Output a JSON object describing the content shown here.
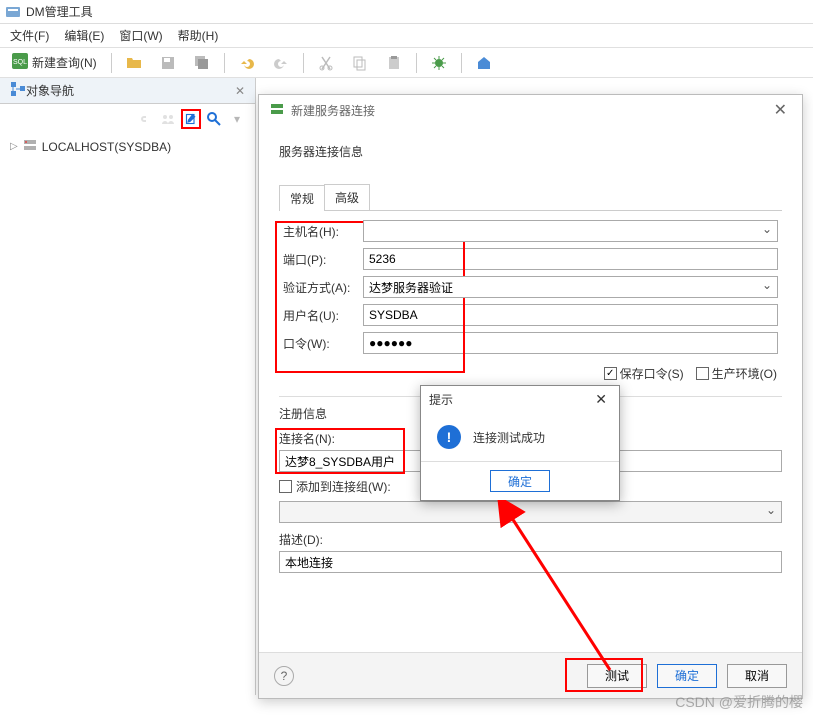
{
  "app": {
    "title": "DM管理工具"
  },
  "menu": {
    "file": "文件(F)",
    "edit": "编辑(E)",
    "window": "窗口(W)",
    "help": "帮助(H)"
  },
  "toolbar": {
    "new_query": "新建查询(N)"
  },
  "sidebar": {
    "tab_title": "对象导航",
    "tree_root": "LOCALHOST(SYSDBA)"
  },
  "dialog": {
    "title": "新建服务器连接",
    "section1": "服务器连接信息",
    "tabs": {
      "general": "常规",
      "advanced": "高级"
    },
    "labels": {
      "host": "主机名(H):",
      "port": "端口(P):",
      "auth": "验证方式(A):",
      "user": "用户名(U):",
      "pwd": "口令(W):"
    },
    "values": {
      "host": "",
      "port": "5236",
      "auth": "达梦服务器验证",
      "user": "SYSDBA",
      "pwd": "●●●●●●"
    },
    "save_pwd": "保存口令(S)",
    "prod_env": "生产环境(O)",
    "section2": "注册信息",
    "conn_name_label": "连接名(N):",
    "conn_name_value": "达梦8_SYSDBA用户",
    "add_group": "添加到连接组(W):",
    "desc_label": "描述(D):",
    "desc_value": "本地连接",
    "buttons": {
      "test": "测试",
      "ok": "确定",
      "cancel": "取消"
    }
  },
  "alert": {
    "title": "提示",
    "message": "连接测试成功",
    "ok": "确定"
  },
  "watermark": "CSDN @爱折腾的樱"
}
